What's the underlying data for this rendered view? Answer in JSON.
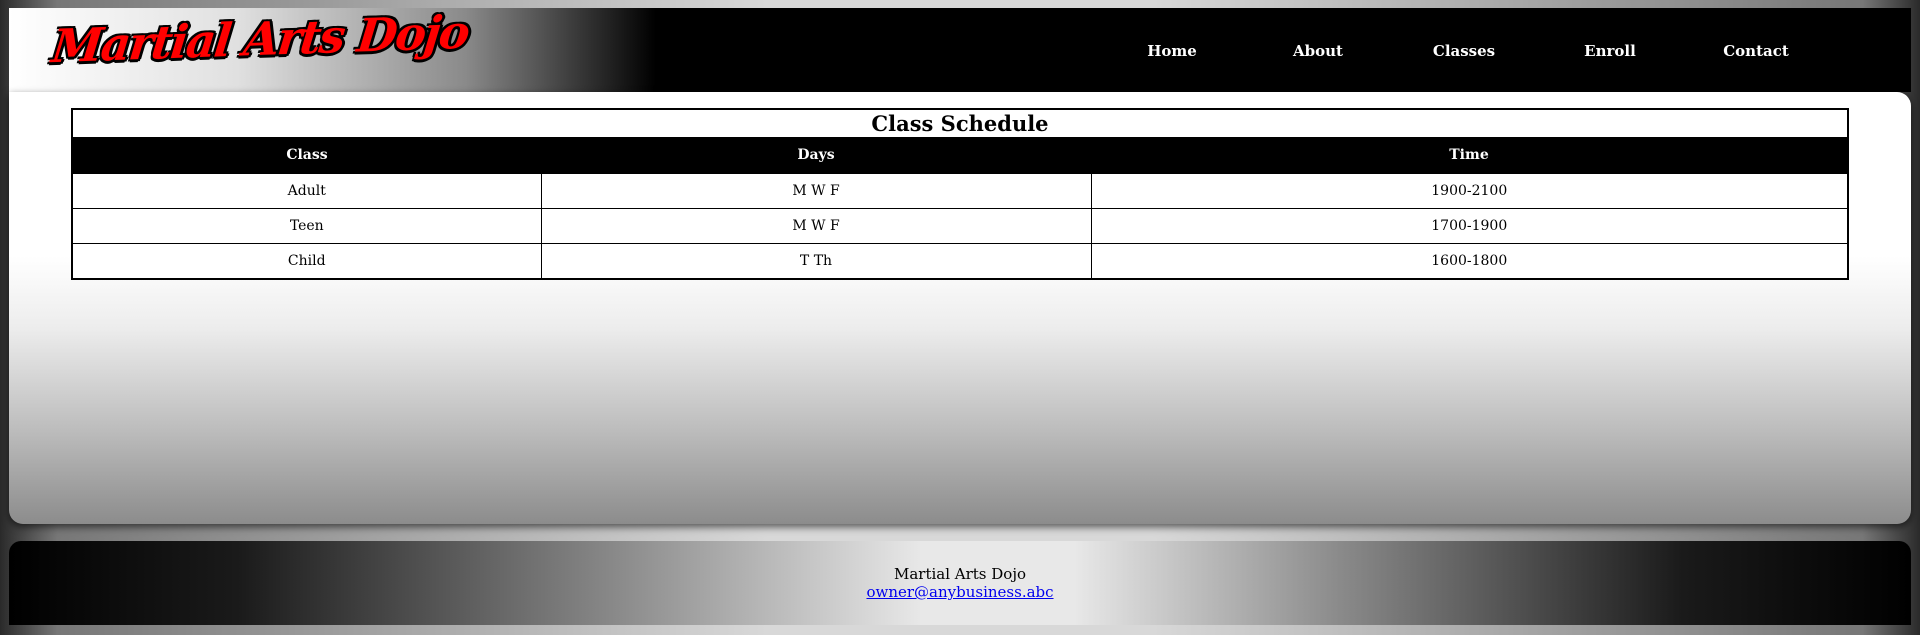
{
  "header": {
    "logo_text": "Martial Arts Dojo",
    "nav": [
      {
        "label": "Home"
      },
      {
        "label": "About"
      },
      {
        "label": "Classes"
      },
      {
        "label": "Enroll"
      },
      {
        "label": "Contact"
      }
    ]
  },
  "schedule": {
    "title": "Class Schedule",
    "columns": [
      "Class",
      "Days",
      "Time"
    ],
    "rows": [
      [
        "Adult",
        "M W F",
        "1900-2100"
      ],
      [
        "Teen",
        "M W F",
        "1700-1900"
      ],
      [
        "Child",
        "T Th",
        "1600-1800"
      ]
    ]
  },
  "footer": {
    "business_name": "Martial Arts Dojo",
    "email": "owner@anybusiness.abc"
  }
}
